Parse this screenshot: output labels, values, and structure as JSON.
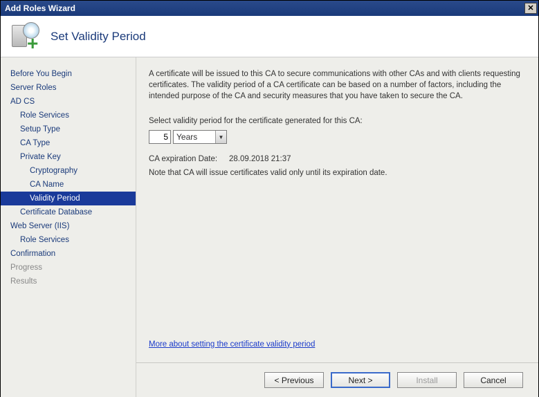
{
  "window": {
    "title": "Add Roles Wizard"
  },
  "header": {
    "title": "Set Validity Period"
  },
  "sidebar": {
    "items": [
      {
        "label": "Before You Begin",
        "level": 1
      },
      {
        "label": "Server Roles",
        "level": 1
      },
      {
        "label": "AD CS",
        "level": 1
      },
      {
        "label": "Role Services",
        "level": 2
      },
      {
        "label": "Setup Type",
        "level": 2
      },
      {
        "label": "CA Type",
        "level": 2
      },
      {
        "label": "Private Key",
        "level": 2
      },
      {
        "label": "Cryptography",
        "level": 3
      },
      {
        "label": "CA Name",
        "level": 3
      },
      {
        "label": "Validity Period",
        "level": 3,
        "selected": true
      },
      {
        "label": "Certificate Database",
        "level": 2
      },
      {
        "label": "Web Server (IIS)",
        "level": 1
      },
      {
        "label": "Role Services",
        "level": 2
      },
      {
        "label": "Confirmation",
        "level": 1
      },
      {
        "label": "Progress",
        "level": 1,
        "dim": true
      },
      {
        "label": "Results",
        "level": 1,
        "dim": true
      }
    ]
  },
  "main": {
    "intro": "A certificate will be issued to this CA to secure communications with other CAs and with clients requesting certificates. The validity period of a CA certificate can be based on a number of factors, including the intended purpose of the CA and security measures that you have taken to secure the CA.",
    "select_label": "Select validity period for the certificate generated for this CA:",
    "period_value": "5",
    "period_unit": "Years",
    "expiration_label": "CA expiration Date:",
    "expiration_value": "28.09.2018 21:37",
    "note": "Note that CA will issue certificates valid only until its expiration date.",
    "link": "More about setting the certificate validity period"
  },
  "buttons": {
    "previous": "< Previous",
    "next": "Next >",
    "install": "Install",
    "cancel": "Cancel"
  }
}
